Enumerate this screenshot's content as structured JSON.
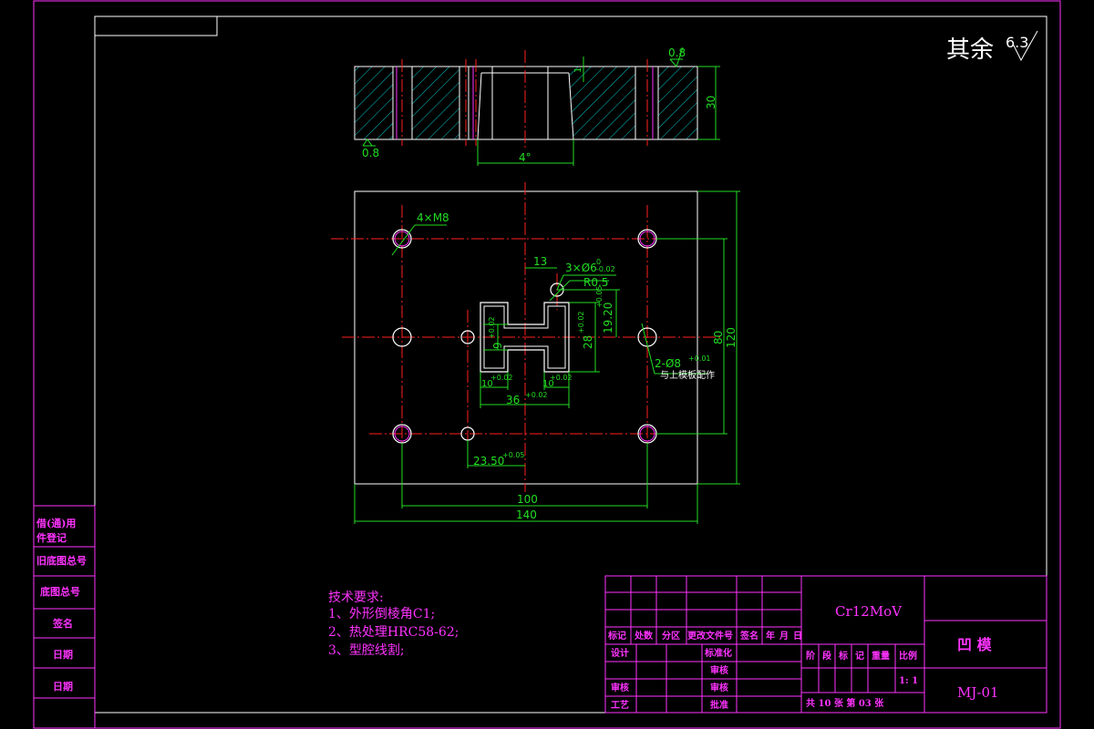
{
  "surface_finish": {
    "label": "其余",
    "value": "6.3"
  },
  "top_view": {
    "roughness_top": "0.8",
    "roughness_bottom": "0.8",
    "height_dim": "30",
    "angle_dim": "4°",
    "chamfer_note": "1"
  },
  "plan_view": {
    "dims": {
      "width_outer": "140",
      "width_holes": "100",
      "height_outer": "120",
      "height_holes": "80",
      "offset_13": "13",
      "dim_36": "36",
      "dim_36_tol": "+0.02",
      "dim_23_5": "23.50",
      "dim_23_5_tol": "+0.05",
      "dim_28": "28",
      "dim_28_tol": "+0.02",
      "dim_19_2": "19.20",
      "dim_19_2_tol": "+0.05",
      "dim_9": "9",
      "dim_9_tol": "+0.02",
      "dim_10_left": "10",
      "dim_10_right": "10",
      "dim_10_tol": "+0.02"
    },
    "callouts": {
      "threads": "4×M8",
      "pins": "3×Ø6",
      "pins_tol_upper": "0",
      "pins_tol_lower": "-0.02",
      "radius": "R0.5",
      "dowels": "2-Ø8",
      "dowels_tol": "+0.01",
      "dowels_note": "与上模板配作"
    }
  },
  "tech_requirements": {
    "title": "技术要求:",
    "items": [
      "1、外形倒棱角C1;",
      "2、热处理HRC58-62;",
      "3、型腔线割;"
    ]
  },
  "side_column": [
    "借(通)用",
    "件登记",
    "旧底图总号",
    "底图总号",
    "签名",
    "日期",
    "日期"
  ],
  "title_block": {
    "material": "Cr12MoV",
    "part_name": "凹 模",
    "drawing_no": "MJ-01",
    "rev_headers": [
      "标记",
      "处数",
      "分区",
      "更改文件号",
      "签名",
      "年",
      "月",
      "日"
    ],
    "roles_left": [
      "设计",
      "审核",
      "工艺"
    ],
    "roles_mid": [
      "标准化",
      "审核",
      "审核",
      "批准"
    ],
    "stage_headers": [
      "阶",
      "段",
      "标",
      "记",
      "重量",
      "比例"
    ],
    "scale": "1: 1",
    "sheet_info": "共 10 张  第 03 张"
  },
  "colors": {
    "outline": "#ffffff",
    "frame": "#ff33ff",
    "centerline": "#ff2020",
    "dimension": "#22dd22",
    "hatch": "#00c8c8",
    "text_magenta": "#ff33ff"
  }
}
